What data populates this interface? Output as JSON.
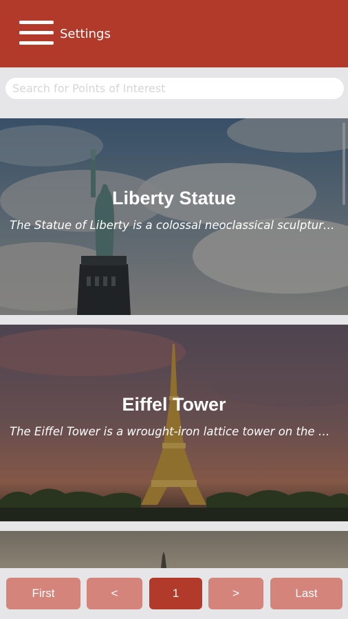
{
  "header": {
    "title": "Settings",
    "menu_icon": "hamburger-menu-icon",
    "color": "#b23a2a"
  },
  "search": {
    "placeholder": "Search for Points of Interest",
    "value": ""
  },
  "cards": [
    {
      "title": "Liberty Statue",
      "description": "The Statue of Liberty is a colossal neoclassical sculpture on Liberty Island in New York Harbor in New York City"
    },
    {
      "title": "Eiffel Tower",
      "description": "The Eiffel Tower is a wrought-iron lattice tower on the Champ de Mars in Paris, France. It is named after the engineer Gustave Eiffel"
    }
  ],
  "pagination": {
    "first": "First",
    "prev": "<",
    "current": "1",
    "next": ">",
    "last": "Last"
  }
}
